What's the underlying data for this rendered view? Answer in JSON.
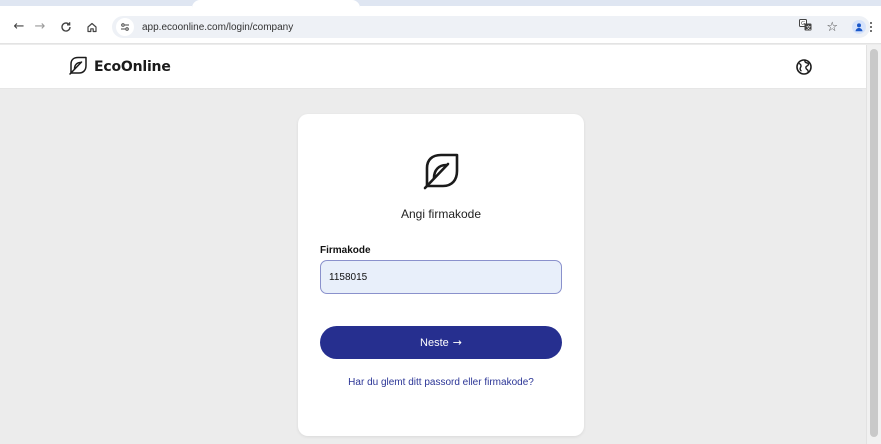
{
  "browser": {
    "url": "app.ecoonline.com/login/company",
    "back_glyph": "←",
    "forward_glyph": "→",
    "reload_glyph": "↻",
    "home_glyph": "⌂",
    "bookmark_glyph": "☆",
    "icons": [
      "back-arrow-icon",
      "forward-arrow-icon",
      "reload-icon",
      "home-icon",
      "site-info-icon",
      "translate-icon",
      "bookmark-star-icon",
      "profile-icon",
      "kebab-menu-icon"
    ]
  },
  "header": {
    "brand_name": "EcoOnline",
    "icons": [
      "ecoonline-logo-icon",
      "globe-icon"
    ]
  },
  "card": {
    "title": "Angi firmakode",
    "field_label": "Firmakode",
    "field_value": "1158015",
    "button_label": "Neste",
    "button_arrow": "→",
    "forgot_link": "Har du glemt ditt passord eller firmakode?"
  },
  "colors": {
    "primary": "#262f8f",
    "link": "#2b3596",
    "input_bg": "#e8effa",
    "input_border": "#8a91cc",
    "page_bg": "#ececec"
  }
}
